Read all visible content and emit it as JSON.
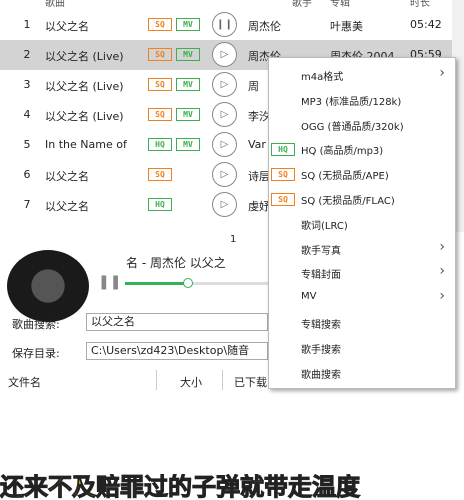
{
  "list": {
    "headers": [
      "歌曲",
      "歌手",
      "专辑",
      "时长"
    ],
    "rows": [
      {
        "num": "1",
        "title": "以父之名",
        "badges": [
          "SQ",
          "MV"
        ],
        "artist": "周杰伦",
        "album": "叶惠美",
        "duration": "05:42",
        "play": "pause"
      },
      {
        "num": "2",
        "title": "以父之名 (Live)",
        "badges": [
          "SQ",
          "MV"
        ],
        "artist": "周杰伦",
        "album": "周杰伦 2004",
        "duration": "05:59",
        "play": "play"
      },
      {
        "num": "3",
        "title": "以父之名 (Live)",
        "badges": [
          "SQ",
          "MV"
        ],
        "artist": "周",
        "album": "",
        "duration": "",
        "play": "play"
      },
      {
        "num": "4",
        "title": "以父之名 (Live)",
        "badges": [
          "SQ",
          "MV"
        ],
        "artist": "李汐",
        "album": "",
        "duration": "",
        "play": "play"
      },
      {
        "num": "5",
        "title": "In the Name of",
        "badges": [
          "HQ",
          "MV"
        ],
        "artist": "Var",
        "album": "",
        "duration": "",
        "play": "play"
      },
      {
        "num": "6",
        "title": "以父之名",
        "badges": [
          "SQ"
        ],
        "artist": "诗层",
        "album": "",
        "duration": "",
        "play": "play"
      },
      {
        "num": "7",
        "title": "以父之名",
        "badges": [
          "HQ"
        ],
        "artist": "虔妤",
        "album": "",
        "duration": "",
        "play": "play"
      }
    ]
  },
  "player": {
    "page_number": "1",
    "now_playing": "名 - 周杰伦  以父之",
    "progress": 0.43,
    "pause_icon": "pause-icon"
  },
  "search": {
    "label": "歌曲搜索:",
    "value": "以父之名"
  },
  "savedir": {
    "label": "保存目录:",
    "value": "C:\\Users\\zd423\\Desktop\\随音"
  },
  "downloads": {
    "col_filename": "文件名",
    "col_size": "大小",
    "col_downloaded": "已下载"
  },
  "lyrics": "还来不及赔罪过的子弹就带走温度",
  "menu": {
    "items": [
      {
        "label": "m4a格式",
        "arrow": true,
        "badge": ""
      },
      {
        "label": "MP3 (标准品质/128k)",
        "arrow": false,
        "badge": ""
      },
      {
        "label": "OGG (普通品质/320k)",
        "arrow": false,
        "badge": ""
      },
      {
        "label": "HQ (高品质/mp3)",
        "arrow": false,
        "badge": "HQ"
      },
      {
        "label": "SQ (无损品质/APE)",
        "arrow": false,
        "badge": "SQ"
      },
      {
        "label": "SQ (无损品质/FLAC)",
        "arrow": false,
        "badge": "SQ"
      },
      {
        "label": "歌词(LRC)",
        "arrow": false,
        "badge": ""
      },
      {
        "label": "歌手写真",
        "arrow": true,
        "badge": ""
      },
      {
        "label": "专辑封面",
        "arrow": true,
        "badge": ""
      },
      {
        "label": "MV",
        "arrow": true,
        "badge": ""
      },
      {
        "label": "专辑搜索",
        "arrow": false,
        "badge": ""
      },
      {
        "label": "歌手搜索",
        "arrow": false,
        "badge": ""
      },
      {
        "label": "歌曲搜索",
        "arrow": false,
        "badge": ""
      }
    ]
  },
  "colors": {
    "sq": "#f08020",
    "mv": "#3cb050",
    "progress": "#2fb35a",
    "lyrics": "#f5c800"
  }
}
